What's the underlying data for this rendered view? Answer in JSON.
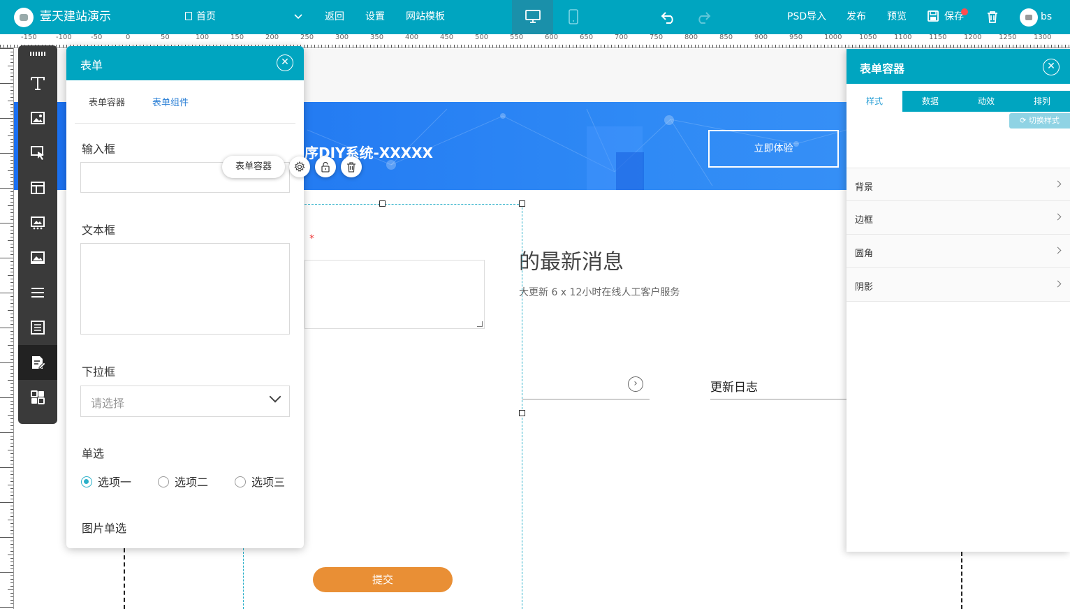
{
  "topbar": {
    "site_name": "壹天建站演示",
    "page": "首页",
    "nav": [
      "返回",
      "设置",
      "网站模板"
    ],
    "actions": [
      "PSD导入",
      "发布",
      "预览",
      "保存"
    ],
    "user": "bs"
  },
  "ruler": {
    "labels": [
      "-150",
      "-100",
      "-50",
      "0",
      "50",
      "100",
      "150",
      "200",
      "250",
      "300",
      "350",
      "400",
      "450",
      "500",
      "550",
      "600",
      "650",
      "700",
      "750",
      "800",
      "850",
      "900",
      "950",
      "1000",
      "1050",
      "1100",
      "1150",
      "1200",
      "1250",
      "1300"
    ]
  },
  "canvas": {
    "banner_title": "序DIY系统-XXXXX",
    "banner_cta": "立即体验",
    "news_title": "的最新消息",
    "news_sub": "大更新    6 x 12小时在线人工客户服务",
    "required_mark": "*",
    "update_log": "更新日志",
    "submit": "提交"
  },
  "floating": {
    "pill_label": "表单容器"
  },
  "form_panel": {
    "title": "表单",
    "tabs": [
      "表单容器",
      "表单组件"
    ],
    "fields": {
      "input_label": "输入框",
      "textarea_label": "文本框",
      "select_label": "下拉框",
      "select_placeholder": "请选择",
      "radio_label": "单选",
      "radio_options": [
        "选项一",
        "选项二",
        "选项三"
      ],
      "image_radio_label": "图片单选"
    }
  },
  "right_panel": {
    "title": "表单容器",
    "tabs": [
      "样式",
      "数据",
      "动效",
      "排列"
    ],
    "switch_style": "切换样式",
    "sections": [
      "背景",
      "边框",
      "圆角",
      "阴影"
    ]
  },
  "colors": {
    "primary": "#00a5c0",
    "banner": "#2f8af5",
    "submit": "#e98f35",
    "active_tab": "#2a9fd6"
  }
}
